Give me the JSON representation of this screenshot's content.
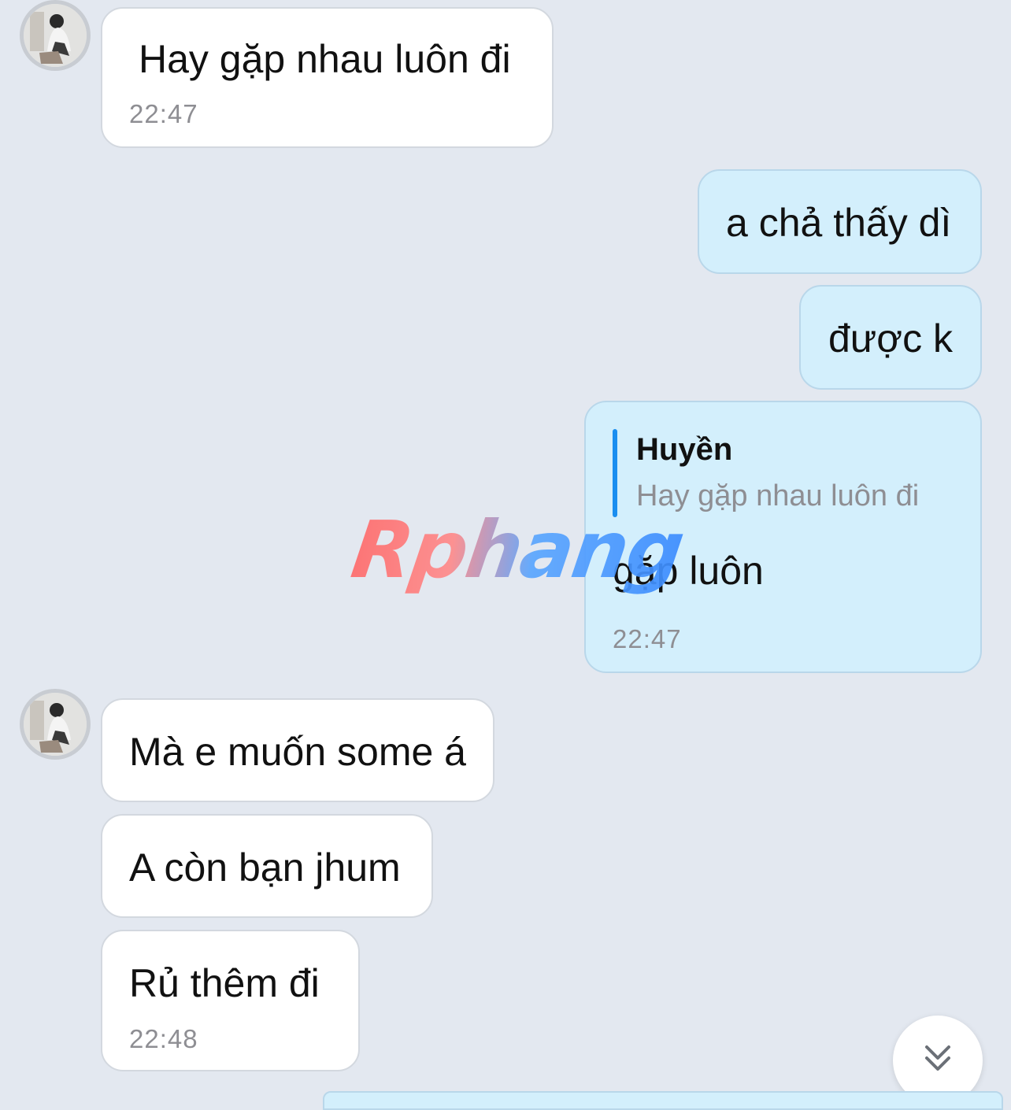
{
  "messages": [
    {
      "direction": "incoming",
      "text": "Hay gặp nhau luôn đi",
      "time": "22:47"
    },
    {
      "direction": "outgoing",
      "text": "a chả thấy dì"
    },
    {
      "direction": "outgoing",
      "text": "được k"
    },
    {
      "direction": "outgoing",
      "reply_to": {
        "name": "Huyền",
        "text": "Hay gặp nhau luôn đi"
      },
      "text": "gặp luôn",
      "time": "22:47"
    },
    {
      "direction": "incoming",
      "text": "Mà e muốn some á"
    },
    {
      "direction": "incoming",
      "text": "A còn bạn jhum"
    },
    {
      "direction": "incoming",
      "text": "Rủ thêm đi",
      "time": "22:48"
    }
  ],
  "watermark": "Rphang",
  "colors": {
    "background": "#e3e8f0",
    "incoming_bubble": "#ffffff",
    "outgoing_bubble": "#d3effc",
    "quote_bar": "#1a8ef0",
    "timestamp": "#8e8e93"
  },
  "icons": {
    "scroll_down": "double-chevron-down-icon",
    "avatar": "avatar"
  }
}
